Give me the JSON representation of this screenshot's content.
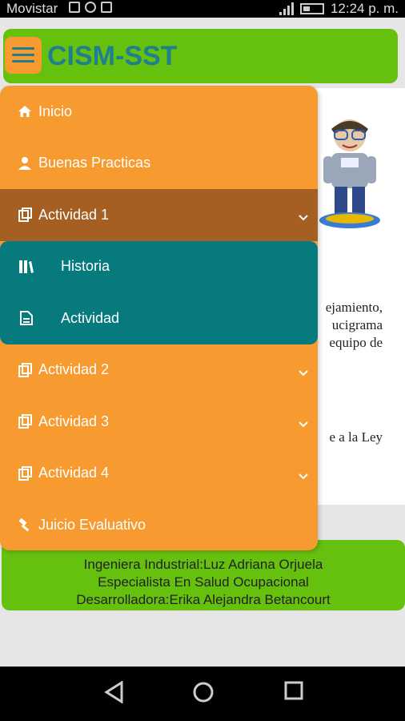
{
  "status_bar": {
    "carrier": "Movistar",
    "time": "12:24 p. m."
  },
  "header": {
    "title": "CISM-SST"
  },
  "content": {
    "snippet_lines": [
      "ejamiento,",
      "ucigrama",
      "equipo de",
      "e a la Ley"
    ]
  },
  "footer": {
    "lines": [
      "Ingeniera Industrial:Luz Adriana Orjuela",
      "Especialista En Salud Ocupacional",
      "Desarrolladora:Erika Alejandra Betancourt"
    ]
  },
  "drawer": {
    "items": [
      {
        "label": "Inicio",
        "icon": "home-icon"
      },
      {
        "label": "Buenas Practicas",
        "icon": "user-icon"
      },
      {
        "label": "Actividad 1",
        "icon": "clipboard-icon",
        "expanded": true
      },
      {
        "label": "Actividad 2",
        "icon": "clipboard-icon"
      },
      {
        "label": "Actividad 3",
        "icon": "clipboard-icon"
      },
      {
        "label": "Actividad 4",
        "icon": "clipboard-icon"
      },
      {
        "label": "Juicio Evaluativo",
        "icon": "gavel-icon"
      }
    ],
    "submenu": [
      {
        "label": "Historia",
        "icon": "books-icon"
      },
      {
        "label": "Actividad",
        "icon": "document-icon"
      }
    ]
  },
  "colors": {
    "header_green": "#66c10f",
    "drawer_orange": "#f79a30",
    "active_brown": "#a55f22",
    "submenu_teal": "#067a7c",
    "title_blue": "#1e7f90"
  }
}
